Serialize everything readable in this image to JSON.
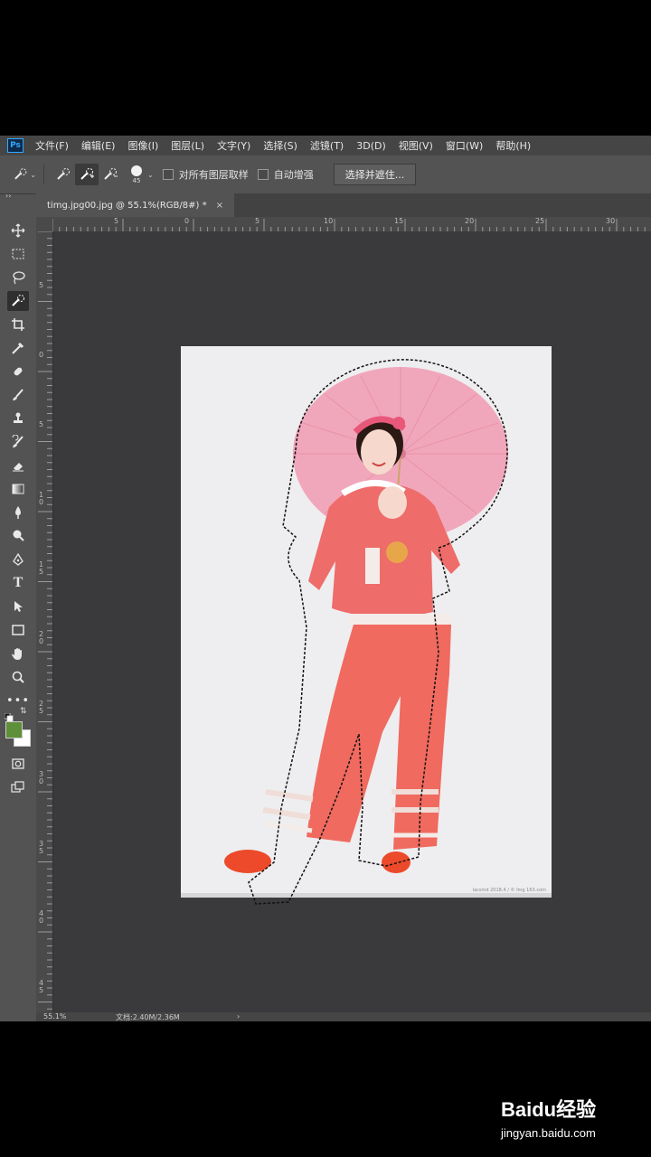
{
  "menubar": {
    "app_icon": "Ps",
    "items": [
      "文件(F)",
      "编辑(E)",
      "图像(I)",
      "图层(L)",
      "文字(Y)",
      "选择(S)",
      "滤镜(T)",
      "3D(D)",
      "视图(V)",
      "窗口(W)",
      "帮助(H)"
    ]
  },
  "options": {
    "brush_size": "45",
    "sample_all_layers_label": "对所有图层取样",
    "auto_enhance_label": "自动增强",
    "select_mask_button": "选择并遮住..."
  },
  "document_tab": {
    "title": "timg.jpg00.jpg @ 55.1%(RGB/8#) *",
    "close": "×"
  },
  "ruler": {
    "h_ticks": [
      "5",
      "0",
      "5",
      "10",
      "15",
      "20",
      "25",
      "30"
    ],
    "v_ticks": [
      "5",
      "0",
      "5",
      "1 0",
      "1 5",
      "2 0",
      "2 5",
      "3 0",
      "3 5",
      "4 0",
      "4 5"
    ]
  },
  "status": {
    "zoom": "55.1%",
    "doc": "文档:2.40M/2.36M",
    "arrow": "›"
  },
  "watermark": {
    "brand": "Baidu经验",
    "url": "jingyan.baidu.com"
  },
  "photo_credit": "lacsmd 2018.4 / © Img 163.com"
}
